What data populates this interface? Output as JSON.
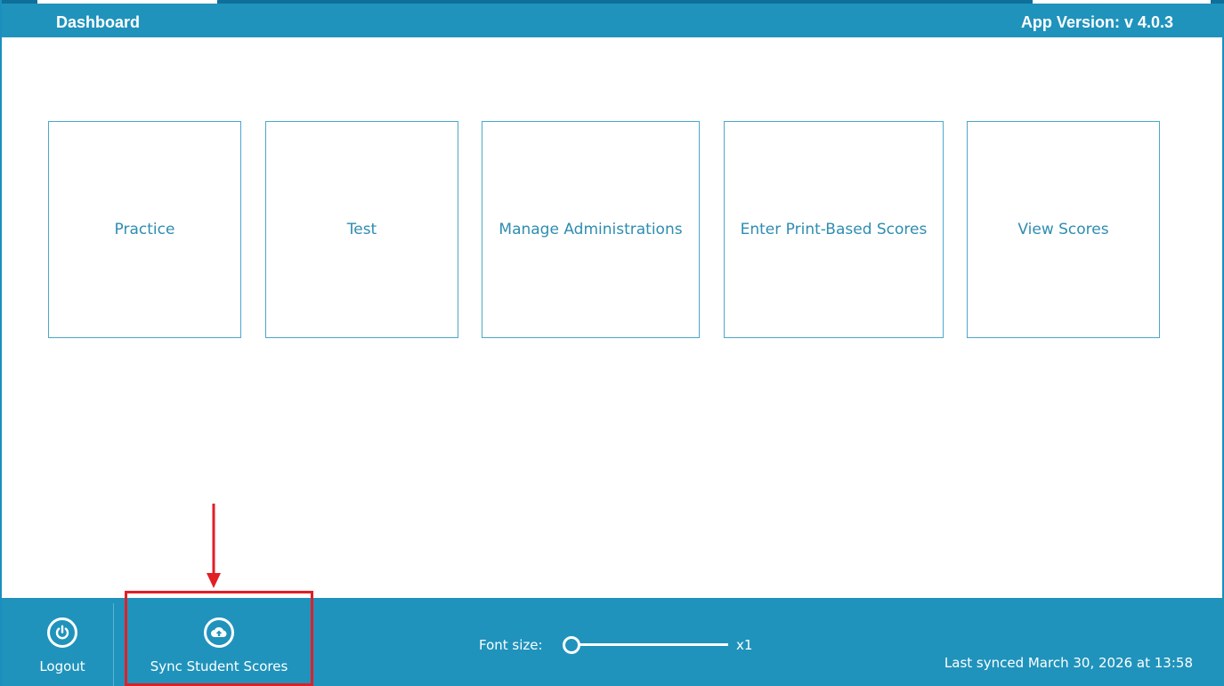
{
  "header": {
    "title": "Dashboard",
    "version": "App Version: v 4.0.3"
  },
  "tiles": [
    {
      "label": "Practice"
    },
    {
      "label": "Test"
    },
    {
      "label": "Manage Administrations"
    },
    {
      "label": "Enter Print-Based Scores"
    },
    {
      "label": "View Scores"
    }
  ],
  "footer": {
    "logout_label": "Logout",
    "logout_icon": "power-icon",
    "sync_label": "Sync Student Scores",
    "sync_icon": "cloud-upload-icon",
    "font_size_label": "Font size:",
    "font_size_value": "x1",
    "font_size_level": 0,
    "last_synced": "Last synced March 30, 2026 at 13:58"
  },
  "colors": {
    "brand": "#1f93bc",
    "tile_text": "#2e8db1",
    "highlight": "#e11f25"
  }
}
